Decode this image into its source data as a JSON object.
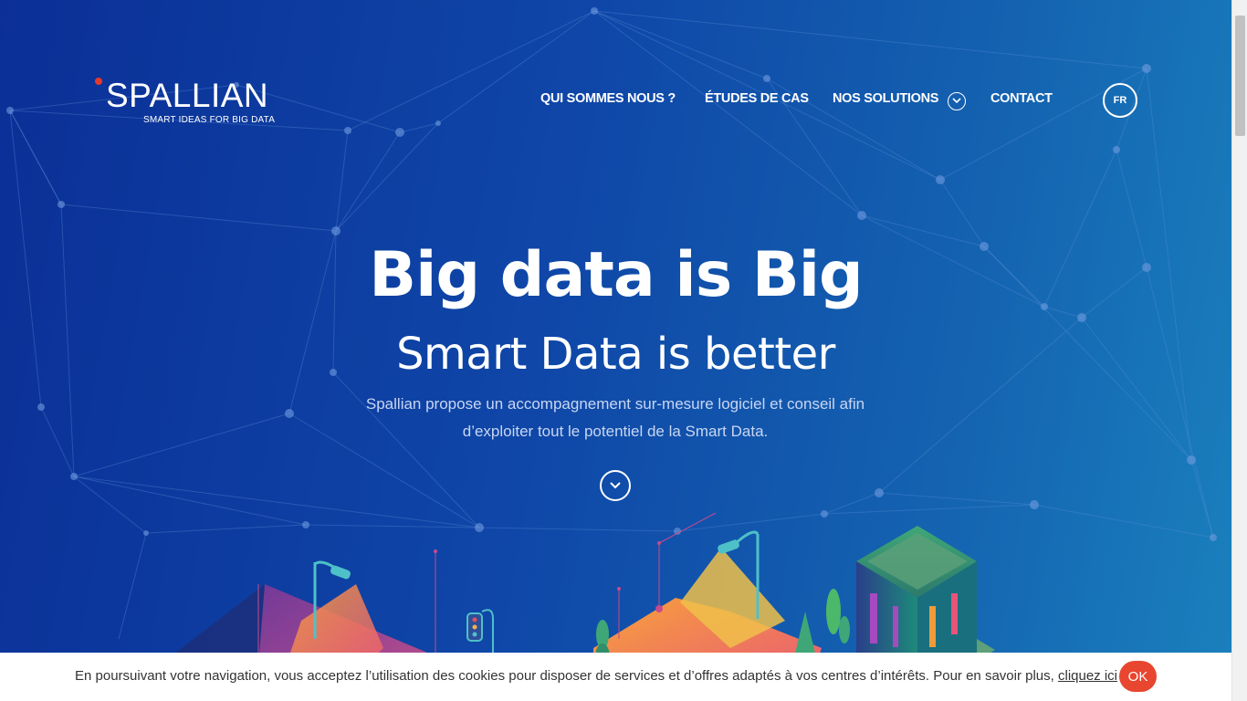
{
  "brand": {
    "name": "SPALLIAN",
    "tagline": "SMART IDEAS FOR BIG DATA",
    "dot_color": "#e5392b"
  },
  "nav": {
    "items": [
      {
        "label": "QUI SOMMES NOUS ?"
      },
      {
        "label": "ÉTUDES DE CAS"
      },
      {
        "label": "NOS SOLUTIONS",
        "icon": "chevron-down-icon"
      },
      {
        "label": "CONTACT"
      }
    ],
    "language": "FR"
  },
  "hero": {
    "title": "Big data is Big",
    "subtitle": "Smart Data is better",
    "description_line1": "Spallian propose un accompagnement sur-mesure logiciel et conseil afin",
    "description_line2": "d’exploiter tout le potentiel de la Smart Data.",
    "scroll_icon": "chevron-down-icon"
  },
  "cookie": {
    "text": "En poursuivant votre navigation, vous acceptez l’utilisation des cookies pour disposer de services et d’offres adaptés à vos centres d’intérêts. Pour en savoir plus, ",
    "link": "cliquez ici",
    "ok": "OK",
    "ok_color": "#e8462f"
  },
  "colors": {
    "gradient_start": "#0b2f96",
    "gradient_end": "#1a80bd"
  }
}
